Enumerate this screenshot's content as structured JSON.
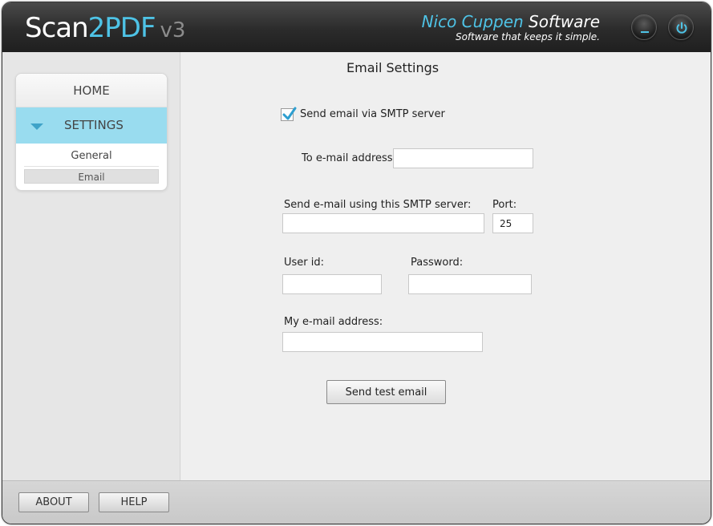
{
  "app": {
    "logo": {
      "part1": "Scan",
      "part2": "2PDF",
      "part3": "v3"
    },
    "brand": {
      "name_part1": "Nico Cuppen",
      "name_part2": " Software",
      "tagline": "Software that keeps it simple."
    },
    "accent_color": "#4ec3e6"
  },
  "header_buttons": [
    {
      "name": "minimize",
      "icon": "minimize-icon"
    },
    {
      "name": "power",
      "icon": "power-icon"
    }
  ],
  "sidebar": {
    "home_label": "HOME",
    "settings_label": "SETTINGS",
    "sub_items": [
      "General",
      "Email"
    ],
    "selected_sub_item": "Email"
  },
  "main": {
    "title": "Email Settings",
    "send_via_smtp": {
      "label": "Send email via SMTP server",
      "checked": true
    },
    "to_email": {
      "label": "To e-mail address:",
      "value": ""
    },
    "smtp_server": {
      "label": "Send e-mail using this SMTP server:",
      "value": ""
    },
    "port": {
      "label": "Port:",
      "value": "25"
    },
    "user_id": {
      "label": "User id:",
      "value": ""
    },
    "password": {
      "label": "Password:",
      "value": ""
    },
    "my_email": {
      "label": "My e-mail address:",
      "value": ""
    },
    "send_test_label": "Send test email"
  },
  "footer": {
    "about_label": "ABOUT",
    "help_label": "HELP"
  }
}
